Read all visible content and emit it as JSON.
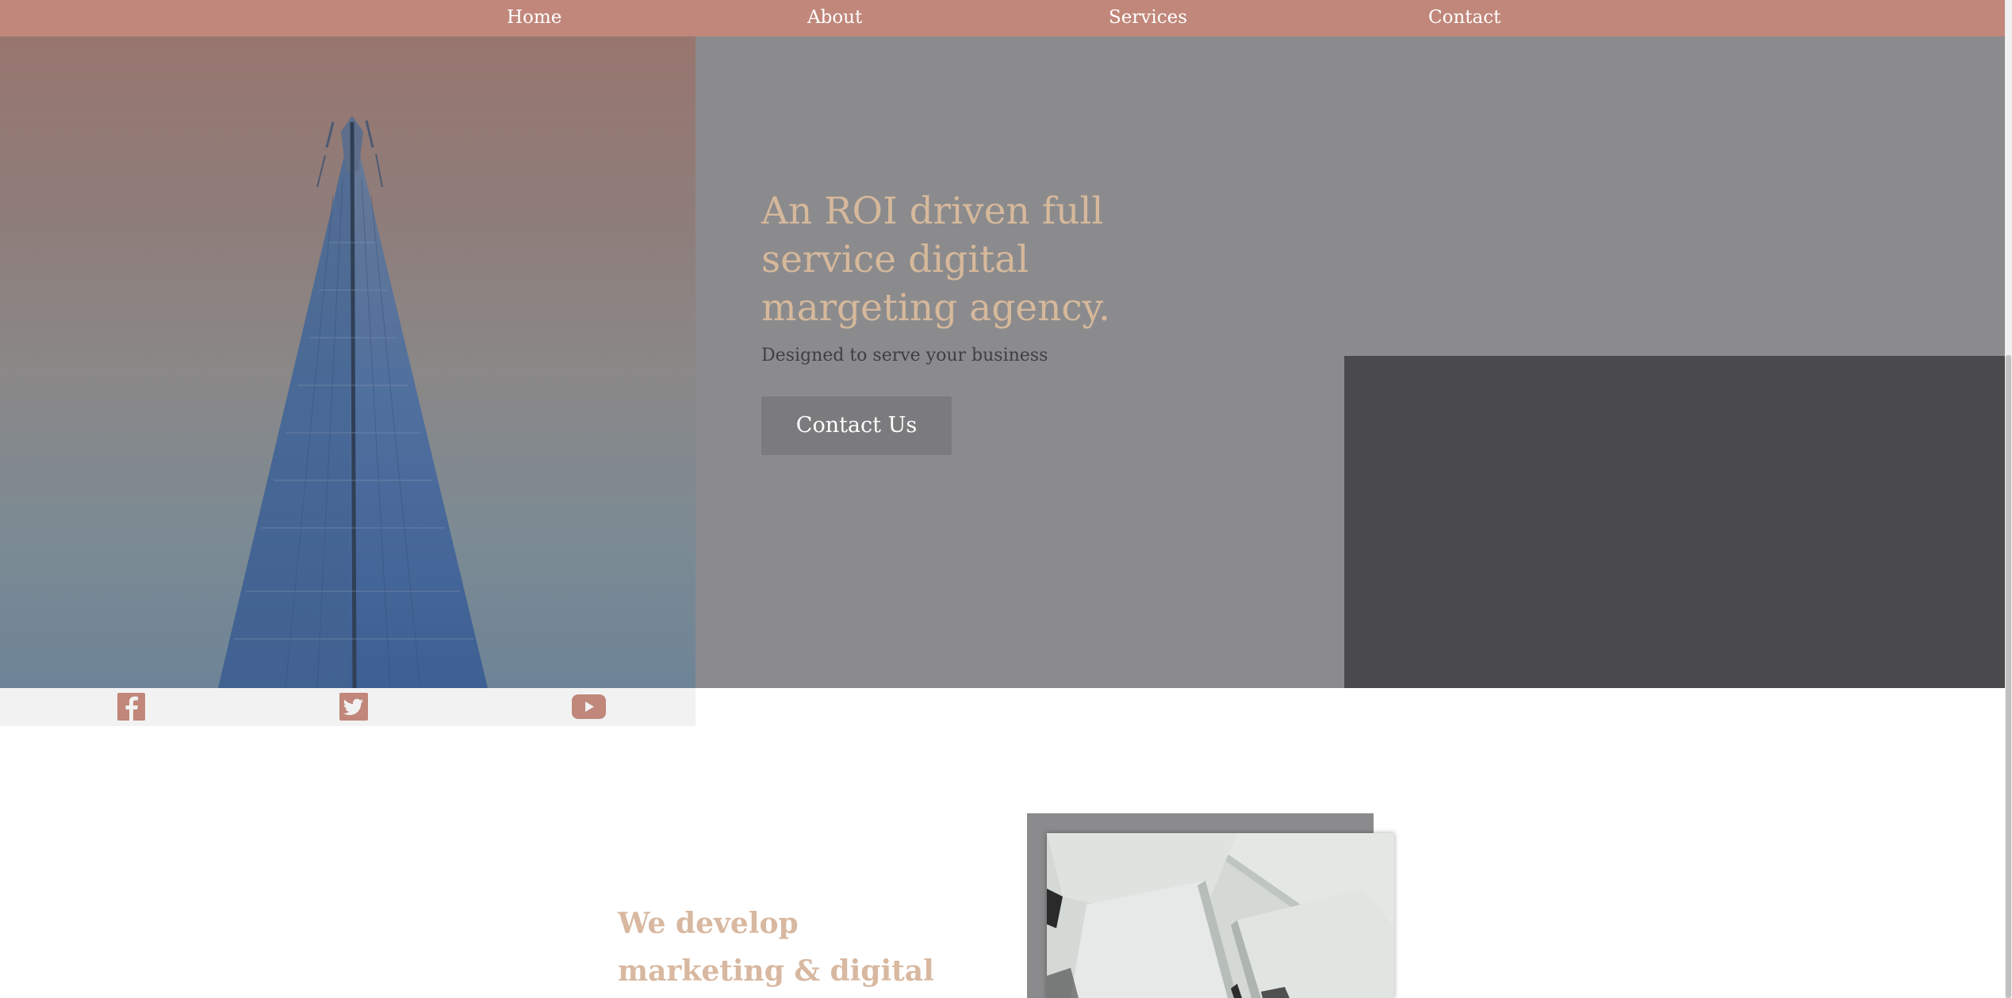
{
  "nav": {
    "items": [
      {
        "label": "Home"
      },
      {
        "label": "About"
      },
      {
        "label": "Services"
      },
      {
        "label": "Contact"
      }
    ]
  },
  "hero": {
    "title": "An ROI driven full service digital margeting agency.",
    "subtitle": "Designed to serve your business",
    "button_label": "Contact Us",
    "image": "building-photo"
  },
  "social": {
    "icons": [
      "facebook-icon",
      "twitter-icon",
      "youtube-icon"
    ]
  },
  "section2": {
    "title": "We develop marketing & digital",
    "image": "paper-sheets-photo"
  },
  "colors": {
    "nav_bg": "#c0877a",
    "accent_text": "#d6b89b",
    "hero_panel": "#8b8b8d",
    "dark_block": "#4a4a4c",
    "button_bg": "#7b7b7d",
    "social_bar": "#f2f2f2",
    "social_icon": "#c0877a"
  }
}
